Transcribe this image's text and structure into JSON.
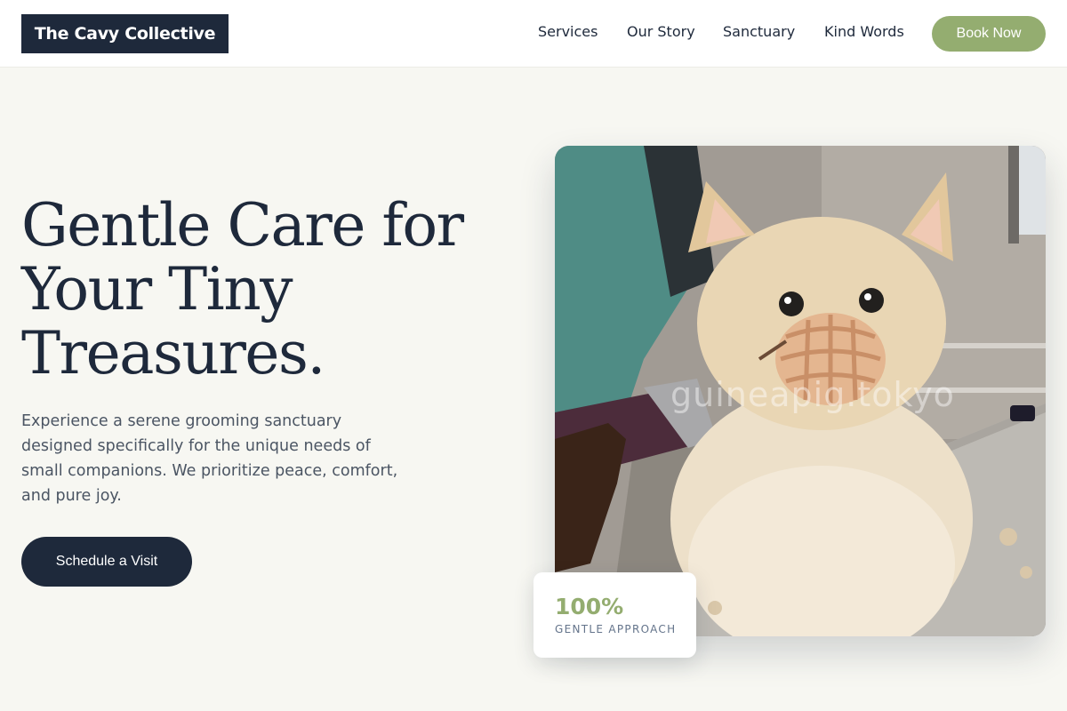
{
  "header": {
    "logo_text": "The Cavy Collective",
    "nav": [
      {
        "label": "Services"
      },
      {
        "label": "Our Story"
      },
      {
        "label": "Sanctuary"
      },
      {
        "label": "Kind Words"
      }
    ],
    "cta_label": "Book Now"
  },
  "hero": {
    "title_lines": [
      "Gentle Care for",
      "Your Tiny",
      "Treasures."
    ],
    "description_lines": [
      "Experience a serene grooming sanctuary",
      "designed specifically for the unique needs of",
      "small companions. We prioritize peace, comfort,",
      "and pure joy."
    ],
    "cta_label": "Schedule a Visit",
    "image_watermark": "guineapig.tokyo"
  },
  "stat_card": {
    "value": "100%",
    "label": "GENTLE APPROACH"
  },
  "colors": {
    "background": "#f7f7f2",
    "navy": "#1e293b",
    "sage": "#94ad70",
    "muted_text": "#4b5563"
  }
}
